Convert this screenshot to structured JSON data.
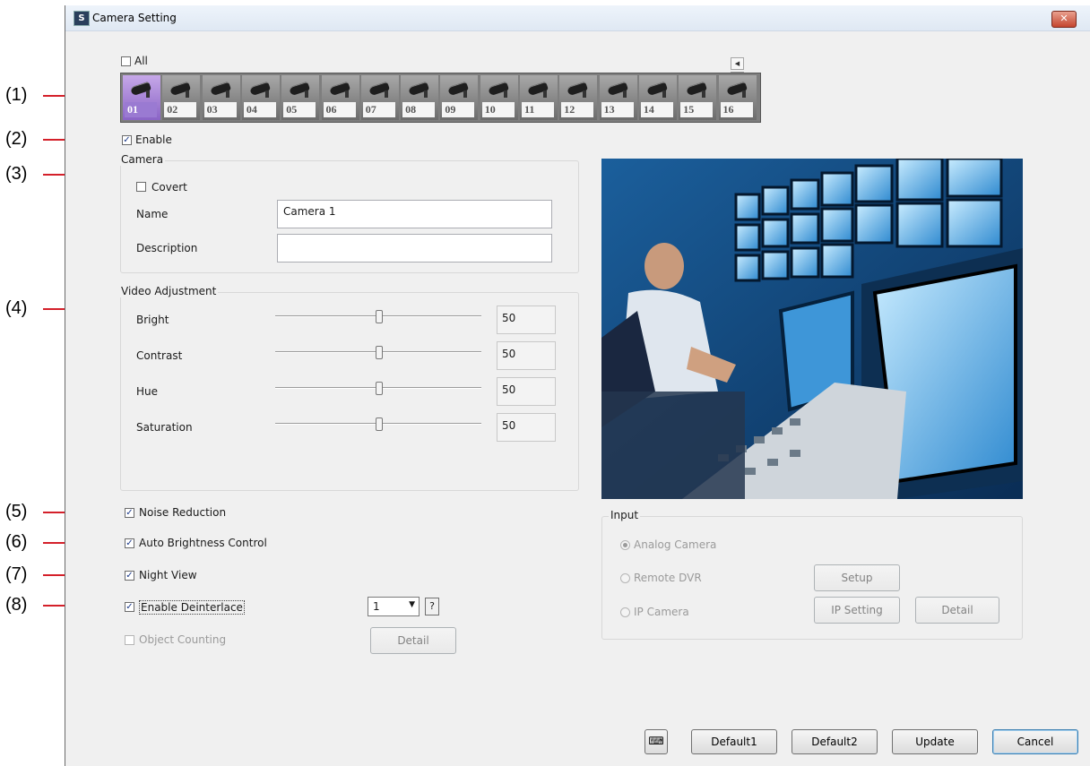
{
  "callouts": [
    "(1)",
    "(2)",
    "(3)",
    "(4)",
    "(5)",
    "(6)",
    "(7)",
    "(8)"
  ],
  "window": {
    "title": "Camera Setting",
    "close_label": "✕"
  },
  "all_label": "All",
  "cameras": [
    "01",
    "02",
    "03",
    "04",
    "05",
    "06",
    "07",
    "08",
    "09",
    "10",
    "11",
    "12",
    "13",
    "14",
    "15",
    "16"
  ],
  "selected_camera": "01",
  "enable_label": "Enable",
  "camera_group": {
    "title": "Camera",
    "covert_label": "Covert",
    "name_label": "Name",
    "name_value": "Camera 1",
    "description_label": "Description",
    "description_value": ""
  },
  "video_adjustment": {
    "title": "Video Adjustment",
    "rows": [
      {
        "label": "Bright",
        "value": "50"
      },
      {
        "label": "Contrast",
        "value": "50"
      },
      {
        "label": "Hue",
        "value": "50"
      },
      {
        "label": "Saturation",
        "value": "50"
      }
    ]
  },
  "options": {
    "noise_reduction": "Noise Reduction",
    "auto_brightness": "Auto Brightness Control",
    "night_view": "Night View",
    "deinterlace": "Enable Deinterlace",
    "deinterlace_value": "1",
    "help": "?",
    "object_counting": "Object Counting",
    "object_detail": "Detail"
  },
  "input_group": {
    "title": "Input",
    "analog": "Analog Camera",
    "remote": "Remote DVR",
    "setup": "Setup",
    "ip": "IP Camera",
    "ip_setting": "IP Setting",
    "detail": "Detail"
  },
  "footer": {
    "default1": "Default1",
    "default2": "Default2",
    "update": "Update",
    "cancel": "Cancel"
  },
  "colors": {
    "callout_line": "#d4202a",
    "selected_camera": "#9a7ad2"
  }
}
